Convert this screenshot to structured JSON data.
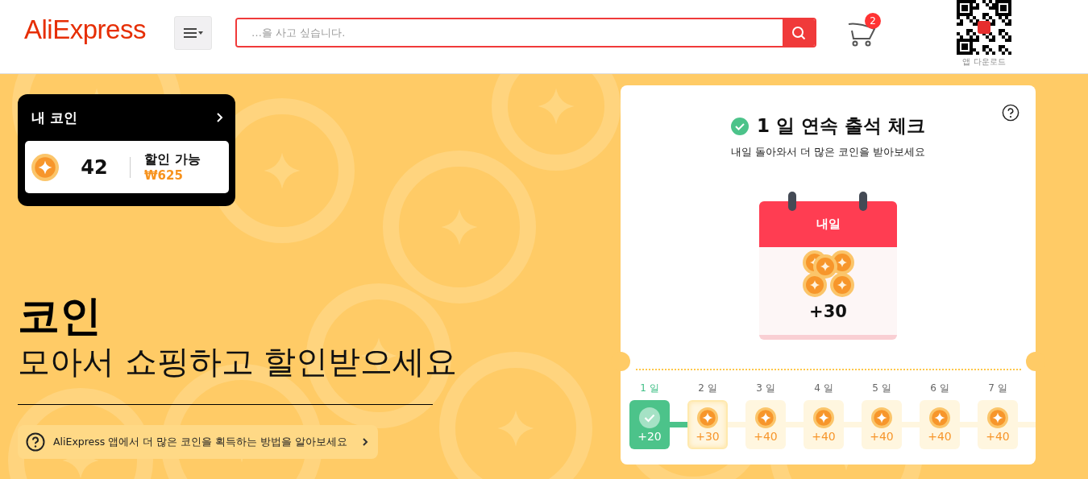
{
  "header": {
    "logo": "AliExpress",
    "search": {
      "placeholder": "…을 사고 싶습니다."
    },
    "cart": {
      "badge": "2"
    },
    "qr": {
      "caption": "앱 다운로드"
    }
  },
  "my_coins": {
    "title": "내 코인",
    "count": "42",
    "discount_label": "할인 가능",
    "discount_value": "₩625"
  },
  "hero": {
    "title": "코인",
    "subtitle": "모아서 쇼핑하고 할인받으세요"
  },
  "info_link": {
    "text": "AliExpress 앱에서 더 많은 코인을 획득하는 방법을 알아보세요"
  },
  "checkin": {
    "title": "1 일 연속 출석 체크",
    "subtitle": "내일 돌아와서 더 많은 코인을 받아보세요",
    "calendar": {
      "label": "내일",
      "reward": "+30"
    },
    "days": [
      {
        "label": "1 일",
        "reward": "+20",
        "done": true,
        "next": false
      },
      {
        "label": "2 일",
        "reward": "+30",
        "done": false,
        "next": true
      },
      {
        "label": "3 일",
        "reward": "+40",
        "done": false,
        "next": false
      },
      {
        "label": "4 일",
        "reward": "+40",
        "done": false,
        "next": false
      },
      {
        "label": "5 일",
        "reward": "+40",
        "done": false,
        "next": false
      },
      {
        "label": "6 일",
        "reward": "+40",
        "done": false,
        "next": false
      },
      {
        "label": "7 일",
        "reward": "+40",
        "done": false,
        "next": false
      }
    ]
  }
}
